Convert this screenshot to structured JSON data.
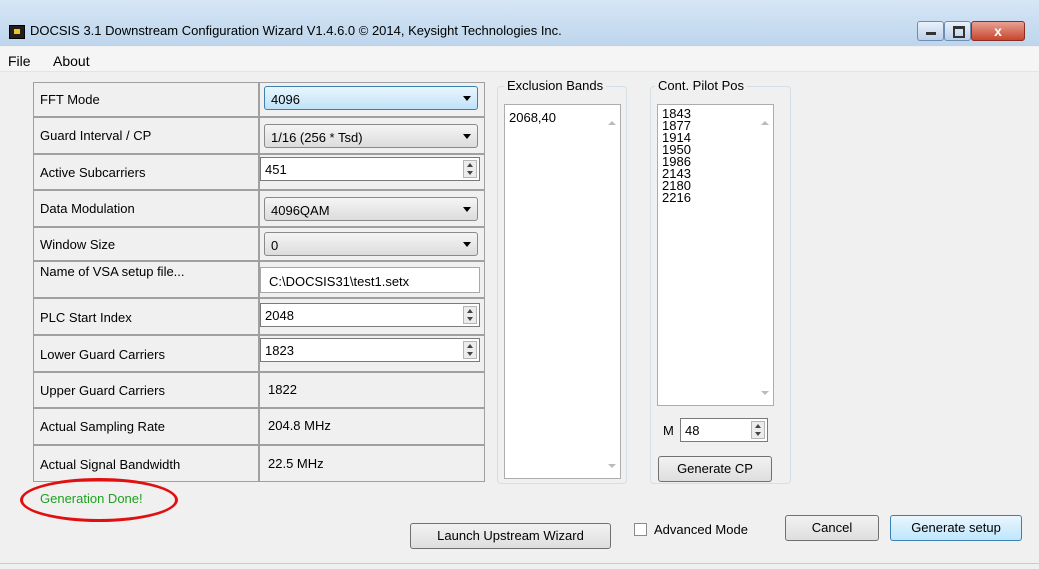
{
  "window": {
    "title": "DOCSIS 3.1 Downstream Configuration Wizard V1.4.6.0  © 2014, Keysight Technologies Inc.",
    "close_glyph": "x"
  },
  "menu": [
    "File",
    "About"
  ],
  "form": {
    "fft_mode": {
      "label": "FFT Mode",
      "value": "4096"
    },
    "guard_interval": {
      "label": "Guard Interval / CP",
      "value": "1/16 (256 * Tsd)"
    },
    "active_subcarriers": {
      "label": "Active Subcarriers",
      "value": "451"
    },
    "data_modulation": {
      "label": "Data Modulation",
      "value": "4096QAM"
    },
    "window_size": {
      "label": "Window Size",
      "value": "0"
    },
    "vsa_setup_file": {
      "label": "Name of VSA setup file...",
      "value": "C:\\DOCSIS31\\test1.setx"
    },
    "plc_start_index": {
      "label": "PLC Start Index",
      "value": "2048"
    },
    "lower_guard": {
      "label": "Lower Guard Carriers",
      "value": "1823"
    },
    "upper_guard": {
      "label": "Upper Guard Carriers",
      "value": "1822"
    },
    "sampling_rate": {
      "label": "Actual Sampling Rate",
      "value": "204.8 MHz"
    },
    "signal_bandwidth": {
      "label": "Actual Signal Bandwidth",
      "value": "22.5 MHz"
    }
  },
  "exclusion_bands": {
    "title": "Exclusion Bands",
    "items": [
      "2068,40"
    ]
  },
  "pilot_positions": {
    "title": "Cont. Pilot Pos",
    "items": [
      "1843",
      "1877",
      "1914",
      "1950",
      "1986",
      "2143",
      "2180",
      "2216"
    ],
    "m_label": "M",
    "m_value": "48",
    "generate_button": "Generate CP"
  },
  "status": "Generation Done!",
  "buttons": {
    "launch_upstream": "Launch Upstream Wizard",
    "advanced_mode": "Advanced Mode",
    "cancel": "Cancel",
    "generate_setup": "Generate setup"
  },
  "colors": {
    "status_text": "#20a020",
    "annotation_ring": "#e01010"
  }
}
